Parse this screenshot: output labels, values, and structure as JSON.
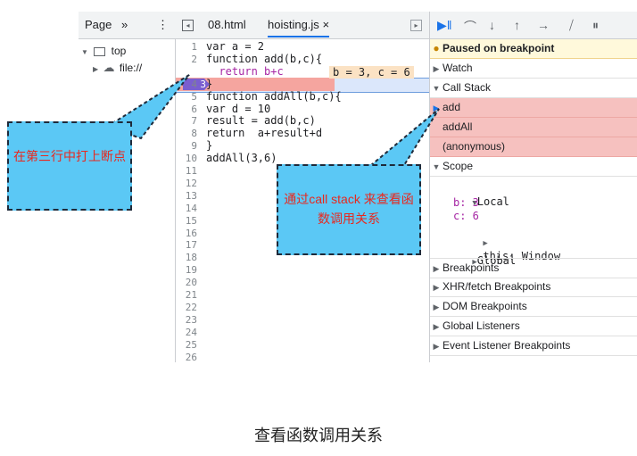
{
  "navigator": {
    "page_tab": "Page",
    "more": "»",
    "menu": "⋮",
    "tree": [
      {
        "label": "top"
      },
      {
        "label": "file://"
      }
    ]
  },
  "editor": {
    "tabs": [
      {
        "label": "08.html"
      },
      {
        "label": "hoisting.js",
        "close": "×"
      }
    ],
    "lines": [
      {
        "n": "1",
        "code": "var a = 2"
      },
      {
        "n": "2",
        "code": "function add(b,c){"
      },
      {
        "n": "3",
        "code": "  return b+c"
      },
      {
        "n": "4",
        "code": "}"
      },
      {
        "n": "5",
        "code": "function addAll(b,c){"
      },
      {
        "n": "6",
        "code": "var d = 10"
      },
      {
        "n": "7",
        "code": "result = add(b,c)"
      },
      {
        "n": "8",
        "code": "return  a+result+d"
      },
      {
        "n": "9",
        "code": "}"
      },
      {
        "n": "10",
        "code": "addAll(3,6)"
      },
      {
        "n": "11",
        "code": ""
      },
      {
        "n": "12",
        "code": ""
      },
      {
        "n": "13",
        "code": ""
      },
      {
        "n": "14",
        "code": ""
      },
      {
        "n": "15",
        "code": ""
      },
      {
        "n": "16",
        "code": ""
      },
      {
        "n": "17",
        "code": ""
      },
      {
        "n": "18",
        "code": ""
      },
      {
        "n": "19",
        "code": ""
      },
      {
        "n": "20",
        "code": ""
      },
      {
        "n": "21",
        "code": ""
      },
      {
        "n": "22",
        "code": ""
      },
      {
        "n": "23",
        "code": ""
      },
      {
        "n": "24",
        "code": ""
      },
      {
        "n": "25",
        "code": ""
      },
      {
        "n": "26",
        "code": ""
      }
    ],
    "inline_value": "b = 3, c = 6",
    "breakpoint_line": "3"
  },
  "debugger": {
    "paused": "Paused on breakpoint",
    "watch": "Watch",
    "call_stack": "Call Stack",
    "frames": [
      "add",
      "addAll",
      "(anonymous)"
    ],
    "scope": "Scope",
    "local": "Local",
    "b_line": "b: 3",
    "c_line": "c: 6",
    "this_line": "this: Window",
    "global": "Global",
    "breakpoints": "Breakpoints",
    "xhr": "XHR/fetch Breakpoints",
    "dom": "DOM Breakpoints",
    "global_listeners": "Global Listeners",
    "event_listeners": "Event Listener Breakpoints"
  },
  "callouts": {
    "left": "在第三行中打上断点",
    "right": "通过call stack 来查看函数调用关系"
  },
  "caption": "查看函数调用关系",
  "colors": {
    "breakpoint_marker": "#7a5fd0",
    "callstack_highlight": "#f6c1bf",
    "callout_fill": "#5bc8f5",
    "callout_text": "#e8281e",
    "paused_banner": "#fff9db"
  }
}
